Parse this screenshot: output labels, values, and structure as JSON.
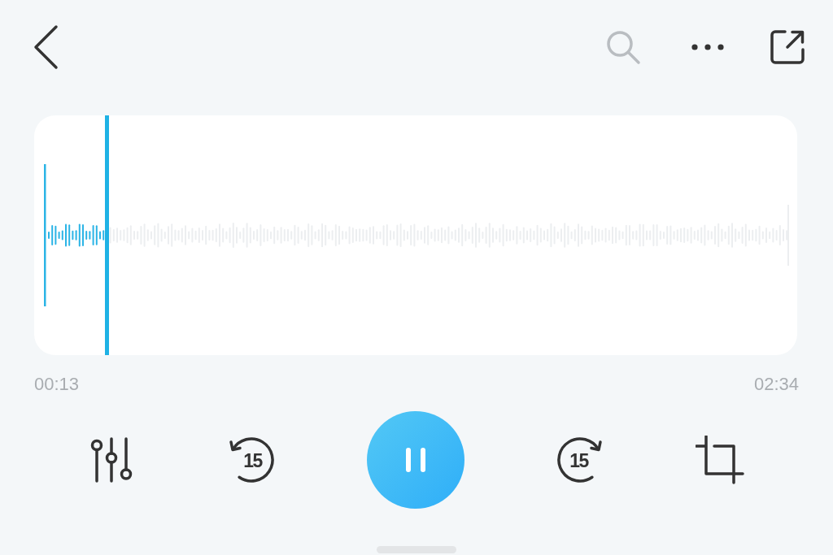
{
  "waveform": {
    "level": 0.084
  },
  "time_elapsed": "00:13",
  "time_total": "02:34",
  "controls": {
    "skip_back": "15",
    "playing": true,
    "skip_forward": "15"
  }
}
